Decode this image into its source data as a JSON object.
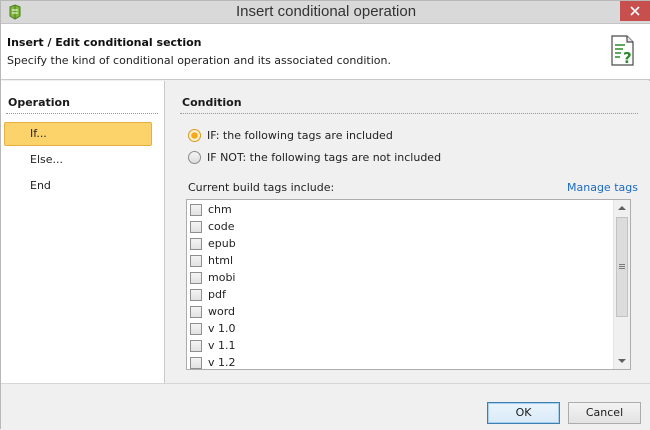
{
  "window": {
    "title": "Insert conditional operation"
  },
  "header": {
    "title": "Insert / Edit conditional section",
    "subtitle": "Specify the kind of conditional operation and its associated condition."
  },
  "operation_panel": {
    "title": "Operation",
    "items": [
      {
        "label": "If...",
        "selected": true
      },
      {
        "label": "Else...",
        "selected": false
      },
      {
        "label": "End",
        "selected": false
      }
    ]
  },
  "condition_panel": {
    "title": "Condition",
    "options": [
      {
        "label": "IF: the following tags are included",
        "checked": true
      },
      {
        "label": "IF NOT: the following tags are not included",
        "checked": false
      }
    ],
    "tags_label": "Current build tags include:",
    "manage_link": "Manage tags",
    "tags": [
      {
        "label": "chm",
        "checked": false
      },
      {
        "label": "code",
        "checked": false
      },
      {
        "label": "epub",
        "checked": false
      },
      {
        "label": "html",
        "checked": false
      },
      {
        "label": "mobi",
        "checked": false
      },
      {
        "label": "pdf",
        "checked": false
      },
      {
        "label": "word",
        "checked": false
      },
      {
        "label": "v 1.0",
        "checked": false
      },
      {
        "label": "v 1.1",
        "checked": false
      },
      {
        "label": "v 1.2",
        "checked": false
      }
    ]
  },
  "footer": {
    "ok_label": "OK",
    "cancel_label": "Cancel"
  },
  "colors": {
    "selection": "#fcd36a",
    "link": "#1a6bc2",
    "close_button": "#c7504f"
  }
}
